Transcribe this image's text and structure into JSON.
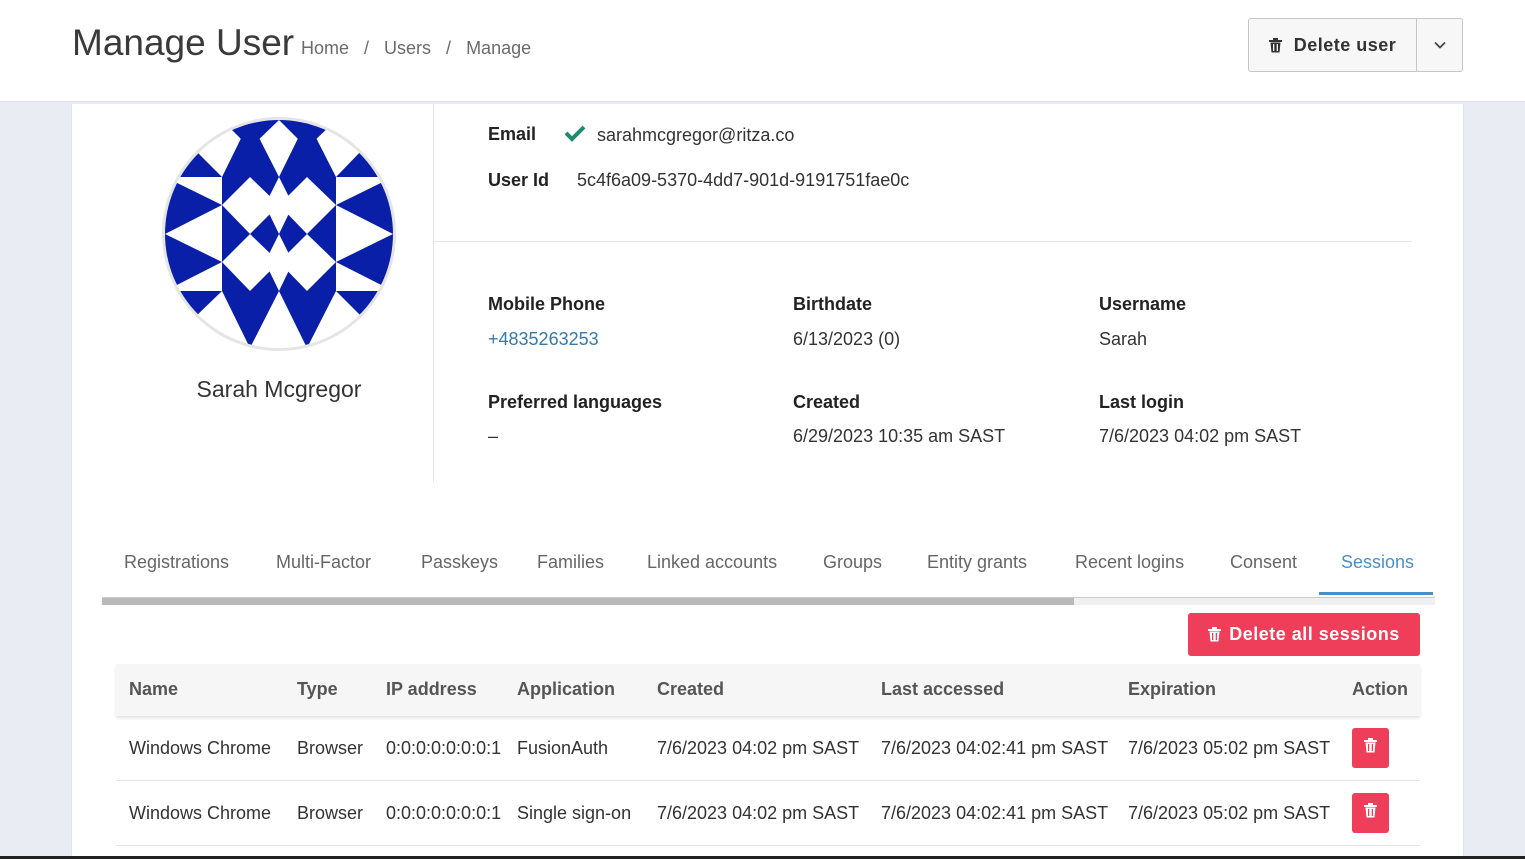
{
  "colors": {
    "accent_blue": "#4a90c8",
    "danger": "#ef3e5a",
    "verified_green": "#1f8a6e",
    "avatar_blue": "#0a1fa8"
  },
  "header": {
    "title": "Manage User",
    "breadcrumb": [
      "Home",
      "Users",
      "Manage"
    ],
    "breadcrumb_separator": "/",
    "delete_user_label": "Delete user"
  },
  "profile": {
    "full_name": "Sarah Mcgregor",
    "email_label": "Email",
    "email": "sarahmcgregor@ritza.co",
    "email_verified_icon": "check-icon",
    "user_id_label": "User Id",
    "user_id": "5c4f6a09-5370-4dd7-901d-9191751fae0c"
  },
  "details": {
    "mobile_phone_label": "Mobile Phone",
    "mobile_phone": "+4835263253",
    "birthdate_label": "Birthdate",
    "birthdate": "6/13/2023 (0)",
    "username_label": "Username",
    "username": "Sarah",
    "preferred_languages_label": "Preferred languages",
    "preferred_languages": "–",
    "created_label": "Created",
    "created": "6/29/2023 10:35 am SAST",
    "last_login_label": "Last login",
    "last_login": "7/6/2023 04:02 pm SAST"
  },
  "tabs": [
    "Registrations",
    "Multi-Factor",
    "Passkeys",
    "Families",
    "Linked accounts",
    "Groups",
    "Entity grants",
    "Recent logins",
    "Consent",
    "Sessions"
  ],
  "active_tab": "Sessions",
  "sessions": {
    "delete_all_label": "Delete all sessions",
    "columns": [
      "Name",
      "Type",
      "IP address",
      "Application",
      "Created",
      "Last accessed",
      "Expiration",
      "Action"
    ],
    "rows": [
      [
        "Windows Chrome",
        "Browser",
        "0:0:0:0:0:0:0:1",
        "FusionAuth",
        "7/6/2023 04:02 pm SAST",
        "7/6/2023 04:02:41 pm SAST",
        "7/6/2023 05:02 pm SAST"
      ],
      [
        "Windows Chrome",
        "Browser",
        "0:0:0:0:0:0:0:1",
        "Single sign-on",
        "7/6/2023 04:02 pm SAST",
        "7/6/2023 04:02:41 pm SAST",
        "7/6/2023 05:02 pm SAST"
      ]
    ]
  }
}
